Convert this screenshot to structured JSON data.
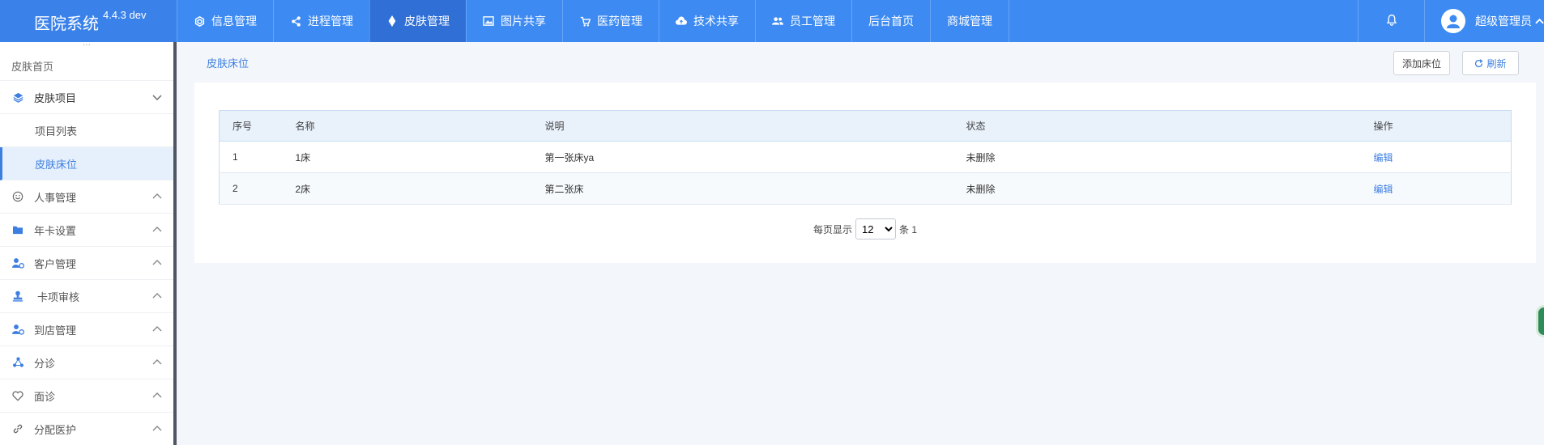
{
  "app": {
    "name": "医院系统",
    "version": "4.4.3 dev"
  },
  "nav": [
    {
      "label": "信息管理",
      "icon": "cube-icon"
    },
    {
      "label": "进程管理",
      "icon": "share-icon"
    },
    {
      "label": "皮肤管理",
      "icon": "diamond-icon",
      "active": true
    },
    {
      "label": "图片共享",
      "icon": "image-icon"
    },
    {
      "label": "医药管理",
      "icon": "cart-icon"
    },
    {
      "label": "技术共享",
      "icon": "cloud-upload-icon"
    },
    {
      "label": "员工管理",
      "icon": "users-icon"
    },
    {
      "label": "后台首页",
      "icon": ""
    },
    {
      "label": "商城管理",
      "icon": ""
    }
  ],
  "user": {
    "name": "超级管理员"
  },
  "sidebar": {
    "home": "皮肤首页",
    "items": [
      {
        "label": "皮肤项目",
        "icon": "layers-icon",
        "expanded": true
      },
      {
        "label": "项目列表"
      },
      {
        "label": "皮肤床位",
        "active": true
      },
      {
        "label": "人事管理",
        "icon": "smile-icon"
      },
      {
        "label": "年卡设置",
        "icon": "folder-icon"
      },
      {
        "label": "客户管理",
        "icon": "user-cog-icon"
      },
      {
        "label": "卡项审核",
        "icon": "stamp-icon"
      },
      {
        "label": "到店管理",
        "icon": "user-cog-icon"
      },
      {
        "label": "分诊",
        "icon": "triage-icon"
      },
      {
        "label": "面诊",
        "icon": "heart-icon"
      },
      {
        "label": "分配医护",
        "icon": "link-icon"
      }
    ]
  },
  "page": {
    "breadcrumb": "皮肤床位",
    "add_button": "添加床位",
    "refresh_button": "刷新"
  },
  "table": {
    "headers": [
      "序号",
      "名称",
      "说明",
      "状态",
      "操作"
    ],
    "rows": [
      {
        "seq": "1",
        "name": "1床",
        "desc": "第一张床ya",
        "status": "未删除",
        "action": "编辑"
      },
      {
        "seq": "2",
        "name": "2床",
        "desc": "第二张床",
        "status": "未删除",
        "action": "编辑"
      }
    ]
  },
  "pager": {
    "prefix": "每页显示",
    "page_size": "12",
    "suffix": "条 1"
  },
  "colors": {
    "topbar": "#3d8bf2",
    "active_nav": "#2f6fd6",
    "link": "#3d7fe0",
    "sidebar_border": "#4e5563"
  }
}
